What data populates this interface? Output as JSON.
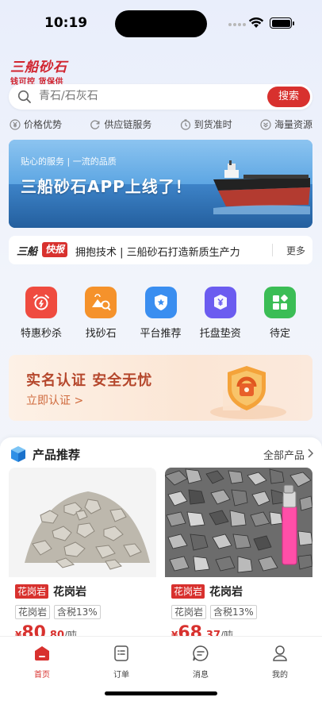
{
  "status_bar": {
    "time": "10:19"
  },
  "logo": {
    "name": "三船砂石",
    "slogan": "钱可控 货保供"
  },
  "search": {
    "placeholder": "青石/石灰石",
    "button_label": "搜索"
  },
  "features": [
    {
      "label": "价格优势",
      "icon": "yen-icon"
    },
    {
      "label": "供应链服务",
      "icon": "refresh-icon"
    },
    {
      "label": "到货准时",
      "icon": "clock-icon"
    },
    {
      "label": "海量资源",
      "icon": "chevron-double-down-icon"
    }
  ],
  "banner": {
    "subtitle": "贴心的服务  |  一流的品质",
    "title": "三船砂石APP上线了！"
  },
  "ticker": {
    "brand": "三船",
    "tag": "快报",
    "text": "拥抱技术 | 三船砂石打造新质生产力",
    "more_label": "更多"
  },
  "quick_menu": [
    {
      "label": "特惠秒杀",
      "icon": "alarm-clock-icon",
      "color": "#ef4b3f"
    },
    {
      "label": "找砂石",
      "icon": "sand-pile-icon",
      "color": "#f5922b"
    },
    {
      "label": "平台推荐",
      "icon": "shield-star-icon",
      "color": "#3a8ef0"
    },
    {
      "label": "托盘垫资",
      "icon": "yen-coin-icon",
      "color": "#6b5cf0"
    },
    {
      "label": "待定",
      "icon": "grid-icon",
      "color": "#3bbd55"
    }
  ],
  "verify": {
    "title": "实名认证  安全无忧",
    "link_label": "立即认证 >"
  },
  "products": {
    "title": "产品推荐",
    "all_label": "全部产品",
    "items": [
      {
        "category": "花岗岩",
        "name": "花岗岩",
        "tags": [
          "花岗岩",
          "含税13%"
        ],
        "currency": "¥",
        "price_int": "80",
        "price_dec": ".80",
        "unit": "/吨"
      },
      {
        "category": "花岗岩",
        "name": "花岗岩",
        "tags": [
          "花岗岩",
          "含税13%"
        ],
        "currency": "¥",
        "price_int": "68",
        "price_dec": ".37",
        "unit": "/吨"
      }
    ]
  },
  "tabbar": [
    {
      "label": "首页",
      "icon": "home-icon",
      "active": true
    },
    {
      "label": "订单",
      "icon": "order-icon",
      "active": false
    },
    {
      "label": "消息",
      "icon": "message-icon",
      "active": false
    },
    {
      "label": "我的",
      "icon": "user-icon",
      "active": false
    }
  ],
  "colors": {
    "brand": "#d8312e",
    "background": "#eef2fb"
  }
}
